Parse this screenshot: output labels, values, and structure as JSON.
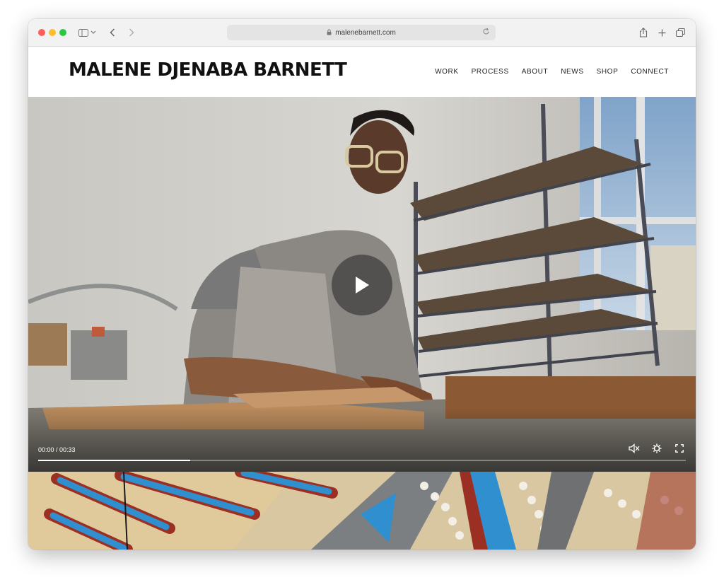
{
  "browser": {
    "url": "malenebarnett.com"
  },
  "site": {
    "logo": "MALENE DJENABA BARNETT",
    "nav": [
      "WORK",
      "PROCESS",
      "ABOUT",
      "NEWS",
      "SHOP",
      "CONNECT"
    ]
  },
  "video": {
    "time_display": "00:00 / 00:33",
    "progress_fraction": 0.235,
    "icons": {
      "play": "play-icon",
      "mute": "mute-icon",
      "settings": "gear-icon",
      "fullscreen": "fullscreen-icon"
    }
  },
  "colors": {
    "accent_blue": "#2f8fcf",
    "tile_red": "#9c2f24"
  }
}
